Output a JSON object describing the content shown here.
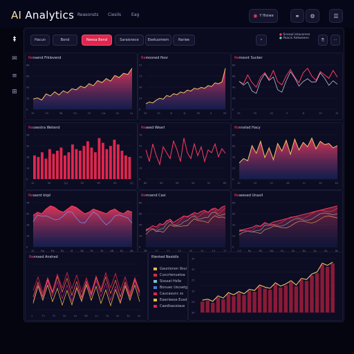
{
  "app": {
    "title_ai": "AI",
    "title_rest": " Analytics"
  },
  "topnav": [
    "Reasonsts",
    "Ciesils",
    "Eag"
  ],
  "top_controls": [
    {
      "label": "Y fllsiwe",
      "icon": "close-icon"
    },
    {
      "label": "",
      "icon": "chat-icon"
    },
    {
      "label": "",
      "icon": "bell-icon"
    },
    {
      "label": "",
      "icon": "settings-icon"
    }
  ],
  "sidebar": [
    {
      "icon": "logo-mark-icon",
      "glyph": "‡"
    },
    {
      "icon": "mail-icon",
      "glyph": "✉"
    },
    {
      "icon": "list-icon",
      "glyph": "≡"
    },
    {
      "icon": "grid-icon",
      "glyph": "⊞"
    }
  ],
  "filters": [
    {
      "label": "Hacun",
      "active": false
    },
    {
      "label": "Bond",
      "active": false
    },
    {
      "label": "Neesa Bend",
      "active": true
    },
    {
      "label": "Saraisnece",
      "active": false
    },
    {
      "label": "Eeetuomem",
      "active": false
    },
    {
      "label": "Rariee",
      "active": false
    }
  ],
  "filter_right": {
    "legend": [
      "Sneaal ielacorere",
      "Yeacis Aetweeen"
    ]
  },
  "panels": [
    {
      "title_red": "Re",
      "title": "nsend Frklevend",
      "type": "area",
      "color": "#ff3b60",
      "ticks": [
        "10",
        "20",
        "58",
        "H1",
        "C5",
        "Cis",
        "Ck",
        "Cs"
      ],
      "values": [
        20,
        22,
        18,
        30,
        26,
        34,
        28,
        36,
        32,
        40,
        38,
        45,
        42,
        50,
        46,
        56,
        52,
        60,
        55,
        66,
        62,
        70,
        68,
        80
      ]
    },
    {
      "title_red": "Ra",
      "title": "mosned fiosr",
      "type": "area",
      "color": "#ff3b60",
      "ticks": [
        "20",
        "10",
        "N",
        "N",
        "55",
        "0",
        "55"
      ],
      "values": [
        12,
        16,
        14,
        20,
        24,
        22,
        30,
        28,
        34,
        32,
        38,
        36,
        42,
        40,
        46,
        44,
        48,
        46,
        52,
        50,
        58,
        56,
        60,
        90
      ]
    },
    {
      "title_red": "Re",
      "title": "mesnt Sucker",
      "type": "lines",
      "color": "#ff3b60",
      "ticks": [
        "10",
        "T0",
        "(Y)",
        "5",
        "D",
        "15",
        "15"
      ],
      "values": [
        50,
        46,
        62,
        48,
        40,
        58,
        66,
        54,
        70,
        50,
        44,
        60,
        72,
        58,
        48,
        66,
        74,
        60,
        52,
        68,
        62,
        56,
        70,
        58
      ]
    },
    {
      "title_red": "Re",
      "title": "ceestra Wetend",
      "type": "bar",
      "color": "#e0264e",
      "ticks": [
        "10",
        "90",
        "(U)",
        "55",
        "99",
        "99",
        "(Y)"
      ],
      "values": [
        30,
        28,
        34,
        26,
        38,
        32,
        36,
        40,
        30,
        34,
        44,
        38,
        36,
        42,
        48,
        40,
        34,
        52,
        46,
        38,
        42,
        50,
        44,
        36,
        30,
        28
      ]
    },
    {
      "title_red": "Re",
      "title": "seed Wearl",
      "type": "line",
      "color": "#ff3b60",
      "ticks": [
        "60",
        "90",
        "99",
        "34",
        "91",
        "85"
      ],
      "values": [
        50,
        30,
        60,
        40,
        25,
        55,
        45,
        35,
        65,
        50,
        30,
        70,
        45,
        35,
        60,
        40,
        55,
        30,
        50,
        45,
        60,
        38,
        52,
        44
      ]
    },
    {
      "title_red": "Ro",
      "title": "nnsted Hacy",
      "type": "area",
      "color": "#ff3b60",
      "ticks": [
        "10",
        "10",
        "12",
        "26",
        "11",
        "20",
        "E2"
      ],
      "values": [
        30,
        38,
        34,
        62,
        48,
        70,
        40,
        58,
        36,
        66,
        52,
        72,
        46,
        74,
        54,
        68,
        60,
        76,
        56,
        70,
        64,
        66,
        58,
        62
      ]
    },
    {
      "title_red": "Re",
      "title": "sasnt kiqd",
      "type": "multiarea",
      "color": "#ff3b60",
      "ticks": [
        "10",
        "Ng",
        "Mk",
        "Rs",
        "M",
        "Dk",
        "Ps",
        "Tb",
        "dB",
        "Ek",
        "dB"
      ],
      "values": [
        40,
        44,
        42,
        48,
        52,
        50,
        46,
        44,
        48,
        52,
        50,
        46,
        42,
        44,
        48,
        46,
        44,
        42,
        46,
        48,
        44,
        42,
        46,
        44
      ]
    },
    {
      "title_red": "Re",
      "title": "rnsend Casi",
      "type": "multiline",
      "color": "#ff3b60",
      "ticks": [
        "3B",
        "17",
        "17",
        "12",
        "15",
        "12",
        "13",
        "17"
      ],
      "values": [
        30,
        34,
        38,
        36,
        42,
        40,
        46,
        50,
        44,
        48,
        52,
        56,
        54,
        58,
        62,
        60,
        64,
        66,
        62,
        68,
        70,
        66,
        72,
        74
      ]
    },
    {
      "title_red": "Re",
      "title": "seesed Unaxil",
      "type": "multiline2",
      "color": "#ff3b60",
      "ticks": [
        "1.9",
        "Ns",
        "Rk",
        "Ws",
        "Sn",
        "Sk",
        "Ds",
        "Ss",
        "Rs",
        "Bs"
      ],
      "values": [
        30,
        32,
        34,
        36,
        40,
        38,
        44,
        42,
        46,
        48,
        50,
        52,
        54,
        56,
        58,
        60,
        62,
        64,
        66,
        68,
        70,
        72,
        74,
        76
      ]
    }
  ],
  "bottom_left": {
    "title_red": "Re",
    "title": "nnsed Anshed",
    "ticks": [
      "1",
      "7n",
      "7k",
      "0n",
      "1a",
      "2B",
      "1n",
      "7p",
      "0s",
      "Es",
      "4n"
    ]
  },
  "bottom_legend": {
    "title": "Riented Nestdls",
    "items": [
      {
        "label": "Gaunlonon 9sui",
        "color": "#e8b84a"
      },
      {
        "label": "Cuccrtenuetoa",
        "color": "#e0264e"
      },
      {
        "label": "Sisssat Hslle",
        "color": "#7bc6c2"
      },
      {
        "label": "Bonuec Uscsetg",
        "color": "#4a7bd8"
      },
      {
        "label": "Caucasunc ss",
        "color": "#e0264e"
      },
      {
        "label": "Eaenleese Eusd",
        "color": "#e8b84a"
      },
      {
        "label": "Caedlsaceiaue",
        "color": "#e0264e"
      }
    ]
  },
  "bottom_right": {
    "ticks": [
      "30",
      "20",
      "10",
      "25",
      "30",
      "35"
    ],
    "values": [
      20,
      22,
      18,
      28,
      24,
      34,
      30,
      36,
      32,
      40,
      38,
      48,
      44,
      42,
      52,
      46,
      50,
      56,
      48,
      60,
      58,
      68,
      72,
      88,
      84,
      90
    ]
  }
}
